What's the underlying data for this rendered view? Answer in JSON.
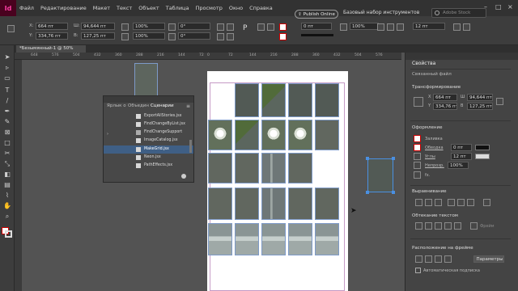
{
  "app": {
    "logo": "Id"
  },
  "menu": [
    "Файл",
    "Редактирование",
    "Макет",
    "Текст",
    "Объект",
    "Таблица",
    "Просмотр",
    "Окно",
    "Справка"
  ],
  "publish_button": "Publish Online",
  "workspace": "Базовый набор инструментов",
  "search_placeholder": "Adobe Stock",
  "control": {
    "x": "664 пт",
    "y": "334,76 пт",
    "w": "94,644 пт",
    "h": "127,25 пт",
    "scale_x": "100%",
    "scale_y": "100%",
    "angle": "0°",
    "shear": "0°",
    "stroke_weight": "0 пт",
    "opacity": "100%",
    "col_w": "12 пт"
  },
  "document_tab": "*Безымянный-1 @ 50%",
  "ruler_ticks": [
    "648",
    "576",
    "504",
    "432",
    "360",
    "288",
    "216",
    "144",
    "72",
    "0",
    "72",
    "144",
    "216",
    "288",
    "360",
    "432",
    "504",
    "576"
  ],
  "scripts_panel": {
    "tabs": [
      "Ярлык о",
      "Объедин",
      "Сценарии"
    ],
    "items": [
      "ExportAllStories.jsx",
      "FindChangeByList.jsx",
      "FindChangeSupport",
      "ImageCatalog.jsx",
      "MakeGrid.jsx",
      "Neon.jsx",
      "PathEffects.jsx"
    ],
    "selected": "MakeGrid.jsx"
  },
  "properties": {
    "panel_title": "Свойства",
    "linked_file": "Связанный файл",
    "transform": "Трансформирование",
    "x": "664 пт",
    "y": "334,76 пт",
    "w": "94,644 пт",
    "h": "127,25 пт",
    "appearance": "Оформление",
    "fill": "Заливка",
    "stroke": "Обводка",
    "stroke_value": "0 пт",
    "corner": "Углы",
    "corner_value": "12 пт",
    "opacity": "Непрозр.",
    "opacity_value": "100%",
    "fx": "fx.",
    "align": "Выравнивание",
    "wrap": "Обтекание текстом",
    "wrap_frame": "Фрейм",
    "arrange": "Расположение на фрейме",
    "params_button": "Параметры",
    "auto_caption": "Автоматическая подписка"
  },
  "colors": {
    "accent": "#4a90e2",
    "selection": "#3f5f85",
    "logo_bg": "#49021f",
    "logo_fg": "#ff3ea5"
  },
  "icons": [
    "selection-tool-icon",
    "direct-selection-tool-icon",
    "page-tool-icon",
    "type-tool-icon",
    "pen-tool-icon",
    "pencil-tool-icon",
    "rectangle-frame-tool-icon",
    "rectangle-tool-icon",
    "scissors-tool-icon",
    "free-transform-tool-icon",
    "gradient-tool-icon",
    "note-tool-icon",
    "eyedropper-tool-icon",
    "hand-tool-icon",
    "zoom-tool-icon",
    "fill-stroke-icon",
    "search-icon",
    "script-icon"
  ]
}
